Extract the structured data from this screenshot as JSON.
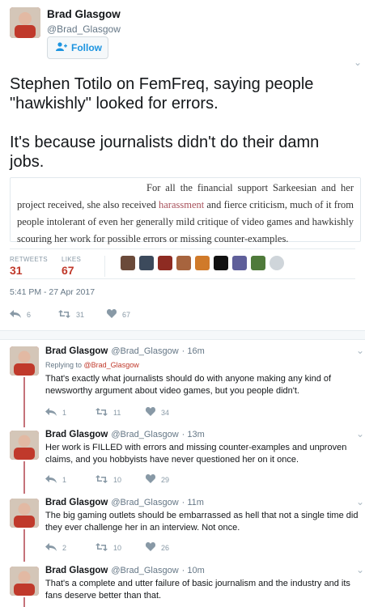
{
  "author": {
    "name": "Brad Glasgow",
    "handle": "@Brad_Glasgow"
  },
  "follow_label": "Follow",
  "tweet": {
    "line1": "Stephen Totilo on FemFreq, saying people",
    "line2": "\"hawkishly\" looked for errors.",
    "line3": "It's because journalists didn't do their damn",
    "line4": "jobs.",
    "quote": {
      "part1": "For all the financial support Sarkeesian and her project received, she also received ",
      "highlight": "harassment",
      "part2": " and fierce criticism, much of it from people intolerant of even her generally mild critique of video games and hawkishly scouring her work for possible errors or missing counter-examples."
    }
  },
  "stats": {
    "retweets_label": "RETWEETS",
    "retweets": "31",
    "likes_label": "LIKES",
    "likes": "67"
  },
  "timestamp": "5:41 PM - 27 Apr 2017",
  "actions": {
    "replies": "6",
    "retweets": "31",
    "likes": "67"
  },
  "replies": [
    {
      "name": "Brad Glasgow",
      "handle": "@Brad_Glasgow",
      "time": "· 16m",
      "replying_label": "Replying to ",
      "replying_to": "@Brad_Glasgow",
      "line1": "That's exactly what journalists should do with anyone making any kind of",
      "line2": "newsworthy argument about video games, but you people didn't.",
      "replies": "1",
      "retweets": "11",
      "likes": "34"
    },
    {
      "name": "Brad Glasgow",
      "handle": "@Brad_Glasgow",
      "time": "· 13m",
      "line1": "Her work is FILLED with errors and missing counter-examples and unproven",
      "line2": "claims, and you hobbyists have never questioned her on it once.",
      "replies": "1",
      "retweets": "10",
      "likes": "29"
    },
    {
      "name": "Brad Glasgow",
      "handle": "@Brad_Glasgow",
      "time": "· 11m",
      "line1": "The big gaming outlets should be embarrassed as hell that not a single time did",
      "line2": "they ever challenge her in an interview. Not once.",
      "replies": "2",
      "retweets": "10",
      "likes": "26"
    },
    {
      "name": "Brad Glasgow",
      "handle": "@Brad_Glasgow",
      "time": "· 10m",
      "line1": "That's a complete and utter failure of basic journalism and the industry and its",
      "line2": "fans deserve better than that."
    }
  ],
  "colors": {
    "accent": "#1da1f2",
    "counts": "#c0392b",
    "handle_mention": "#c0392b",
    "thread_line": "#c5727a"
  }
}
